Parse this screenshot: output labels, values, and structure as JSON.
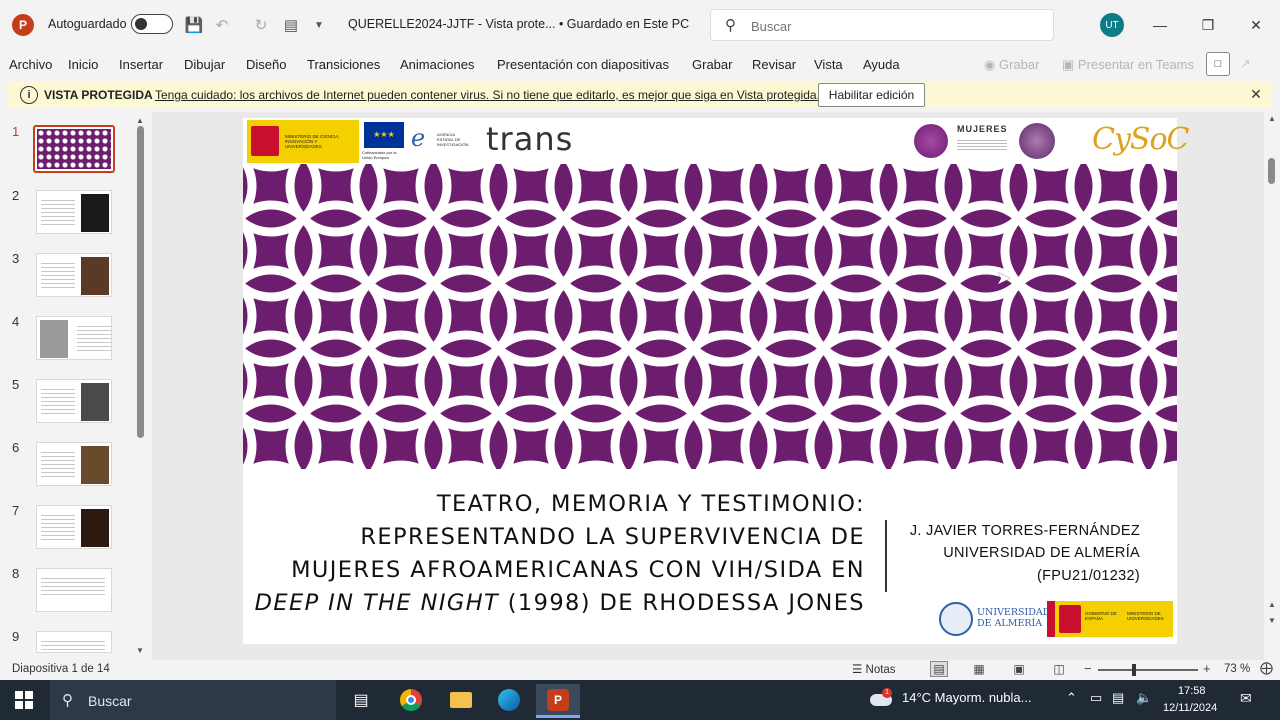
{
  "titlebar": {
    "autosave_label": "Autoguardado",
    "doc_title": "QUERELLE2024-JJTF  -  Vista prote...  •  Guardado en Este PC",
    "search_placeholder": "Buscar",
    "avatar_initials": "UT"
  },
  "menu": {
    "items": [
      "Archivo",
      "Inicio",
      "Insertar",
      "Dibujar",
      "Diseño",
      "Transiciones",
      "Animaciones",
      "Presentación con diapositivas",
      "Grabar",
      "Revisar",
      "Vista",
      "Ayuda"
    ],
    "record_label": "Grabar",
    "teams_label": "Presentar en Teams"
  },
  "protected_view": {
    "title": "VISTA PROTEGIDA",
    "message": "Tenga cuidado: los archivos de Internet pueden contener virus. Si no tiene que editarlo, es mejor que siga en Vista protegida.",
    "enable_button": "Habilitar edición"
  },
  "thumbnails": [
    "1",
    "2",
    "3",
    "4",
    "5",
    "6",
    "7",
    "8",
    "9"
  ],
  "slide": {
    "title_lines": [
      "TEATRO, MEMORIA Y TESTIMONIO:",
      "REPRESENTANDO LA SUPERVIVENCIA DE",
      "MUJERES AFROAMERICANAS CON VIH/SIDA EN"
    ],
    "title_last_italic": "DEEP IN THE NIGHT",
    "title_last_rest": " (1998) DE RHODESSA JONES",
    "author": "J. JAVIER TORRES-FERNÁNDEZ",
    "affiliation": "UNIVERSIDAD DE ALMERÍA",
    "grant": "(FPU21/01232)",
    "logos": {
      "ministry": "MINISTERIO DE CIENCIA, INNOVACIÓN Y UNIVERSIDADES",
      "eu": "Cofinanciado por la Unión Europea",
      "aei": "AGENCIA ESTATAL DE INVESTIGACIÓN",
      "trans": "trans",
      "mujeres": "MUJERES",
      "cysoc": "CySoC",
      "ual": "UNIVERSIDAD DE ALMERÍA",
      "gobierno": "GOBIERNO DE ESPAÑA",
      "ministerio_univ": "MINISTERIO DE UNIVERSIDADES"
    },
    "pattern_color": "#6d1d6e"
  },
  "status": {
    "slide_counter": "Diapositiva 1 de 14",
    "notes_label": "Notas",
    "zoom": "73 %"
  },
  "taskbar": {
    "search_label": "Buscar",
    "weather": "14°C  Mayorm. nubla...",
    "time": "17:58",
    "date": "12/11/2024"
  }
}
